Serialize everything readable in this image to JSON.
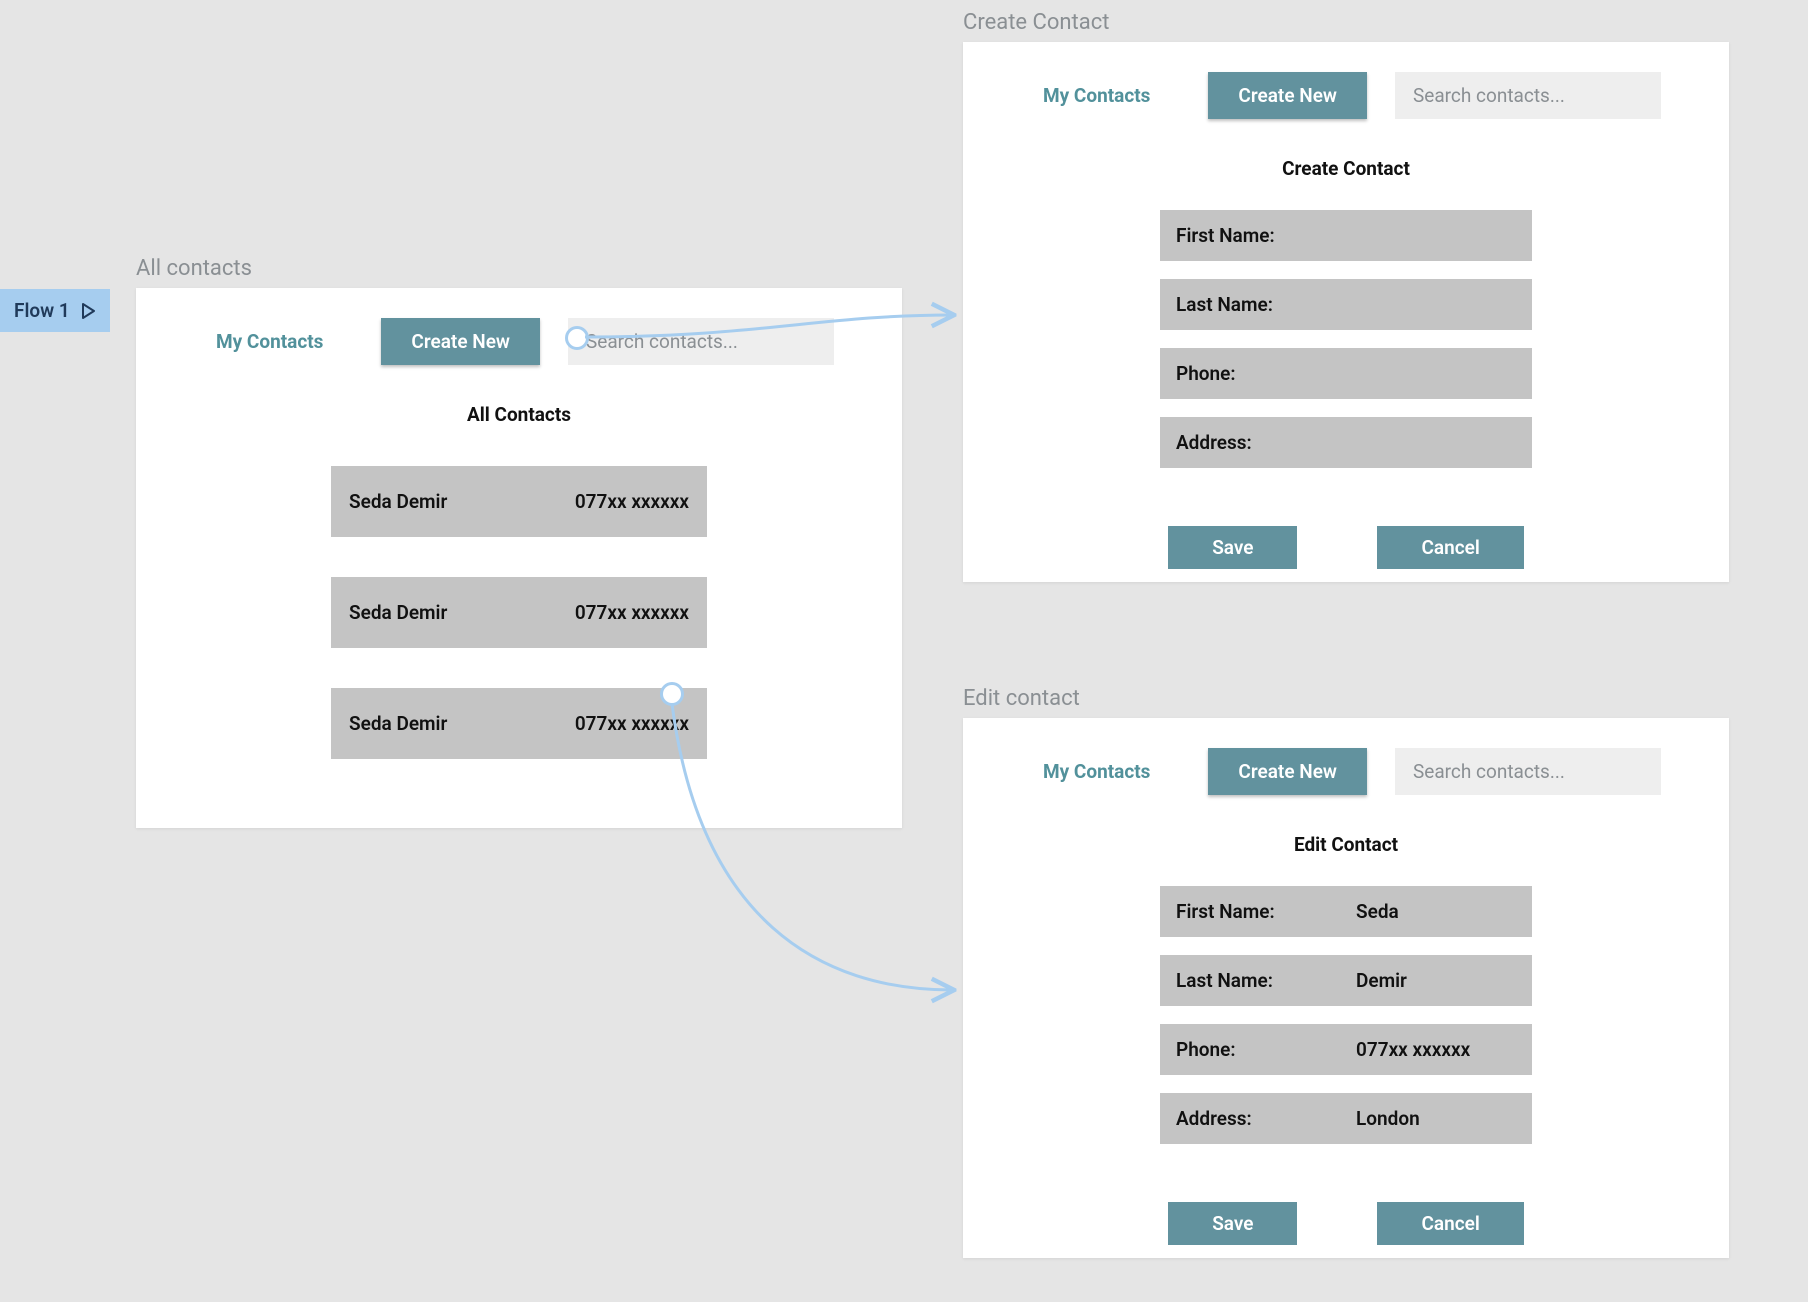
{
  "flow_tag": "Flow 1",
  "brand": "My Contacts",
  "create_btn": "Create New",
  "search_placeholder": "Search contacts...",
  "save": "Save",
  "cancel": "Cancel",
  "screens": {
    "all": {
      "title": "All contacts",
      "heading": "All Contacts",
      "rows": [
        {
          "name": "Seda Demir",
          "phone": "077xx xxxxxx"
        },
        {
          "name": "Seda Demir",
          "phone": "077xx xxxxxx"
        },
        {
          "name": "Seda Demir",
          "phone": "077xx xxxxxx"
        }
      ]
    },
    "create": {
      "title": "Create Contact",
      "heading": "Create Contact",
      "fields": {
        "first": {
          "label": "First Name:",
          "value": ""
        },
        "last": {
          "label": "Last Name:",
          "value": ""
        },
        "phone": {
          "label": "Phone:",
          "value": ""
        },
        "addr": {
          "label": "Address:",
          "value": ""
        }
      }
    },
    "edit": {
      "title": "Edit contact",
      "heading": "Edit Contact",
      "fields": {
        "first": {
          "label": "First Name:",
          "value": "Seda"
        },
        "last": {
          "label": "Last Name:",
          "value": "Demir"
        },
        "phone": {
          "label": "Phone:",
          "value": "077xx xxxxxx"
        },
        "addr": {
          "label": "Address:",
          "value": "London"
        }
      }
    }
  }
}
